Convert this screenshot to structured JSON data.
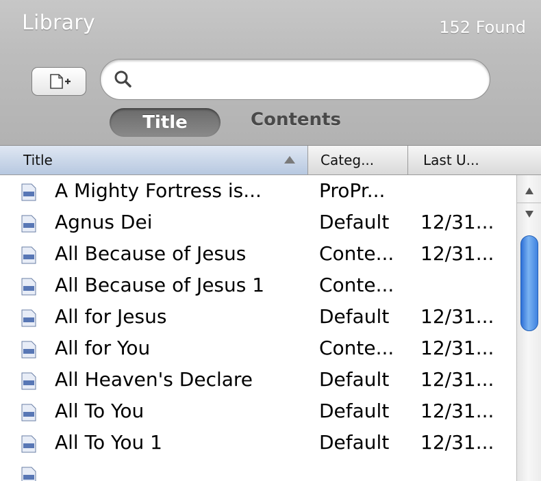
{
  "header": {
    "title": "Library",
    "found_count": "152 Found"
  },
  "toolbar": {
    "new_item_icon": "new-document-icon",
    "search_icon": "search-icon",
    "search_value": "",
    "search_placeholder": ""
  },
  "scope": {
    "tabs": [
      {
        "label": "Title",
        "selected": true
      },
      {
        "label": "Contents",
        "selected": false
      }
    ]
  },
  "table": {
    "columns": [
      {
        "label": "Title",
        "sort": "ascending"
      },
      {
        "label": "Categ..."
      },
      {
        "label": "Last U..."
      }
    ],
    "rows": [
      {
        "title": "A Mighty Fortress is...",
        "category": "ProPr...",
        "last": ""
      },
      {
        "title": "Agnus Dei",
        "category": "Default",
        "last": "12/31..."
      },
      {
        "title": "All Because of Jesus",
        "category": "Conte...",
        "last": "12/31..."
      },
      {
        "title": "All Because of Jesus 1",
        "category": "Conte...",
        "last": ""
      },
      {
        "title": "All for Jesus",
        "category": "Default",
        "last": "12/31..."
      },
      {
        "title": "All for You",
        "category": "Conte...",
        "last": "12/31..."
      },
      {
        "title": "All Heaven's Declare",
        "category": "Default",
        "last": "12/31..."
      },
      {
        "title": "All To You",
        "category": "Default",
        "last": "12/31..."
      },
      {
        "title": "All To You 1",
        "category": "Default",
        "last": "12/31..."
      },
      {
        "title": "",
        "category": "",
        "last": ""
      }
    ]
  },
  "colors": {
    "accent": "#3f82e0",
    "header_bg": "#bdbdbd",
    "selected_segment": "#6a6a6a"
  }
}
